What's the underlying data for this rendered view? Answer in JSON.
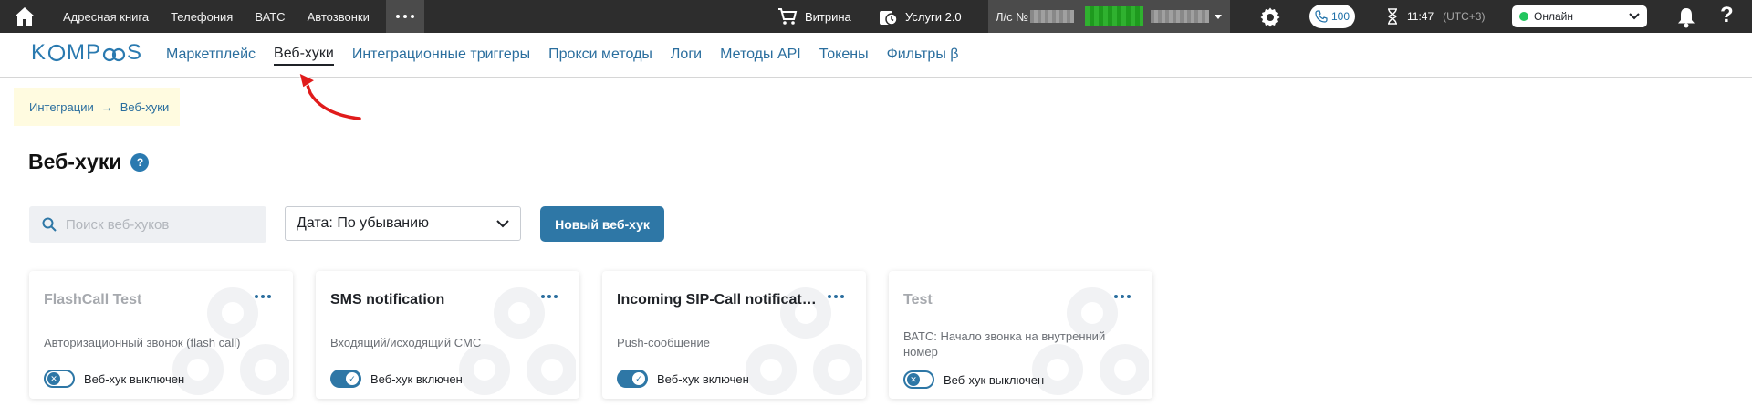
{
  "topbar": {
    "links": [
      "Адресная книга",
      "Телефония",
      "ВАТС",
      "Автозвонки"
    ],
    "shop_label": "Витрина",
    "services_label": "Услуги 2.0",
    "account_prefix": "Л/с №",
    "calls_count": "100",
    "time": "11:47",
    "timezone": "(UTC+3)",
    "status": "Онлайн",
    "help": "?"
  },
  "subnav": {
    "logo_prefix": "K",
    "logo_middle": "MP",
    "logo_suffix": "S",
    "items": [
      "Маркетплейс",
      "Веб-хуки",
      "Интеграционные триггеры",
      "Прокси методы",
      "Логи",
      "Методы API",
      "Токены",
      "Фильтры β"
    ],
    "active_index": 1
  },
  "breadcrumb": {
    "parent": "Интеграции",
    "separator": "→",
    "current": "Веб-хуки"
  },
  "page": {
    "title": "Веб-хуки",
    "help": "?"
  },
  "controls": {
    "search_placeholder": "Поиск веб-хуков",
    "sort_label": "Дата: По убыванию",
    "new_button": "Новый веб-хук"
  },
  "cards": [
    {
      "title": "FlashCall Test",
      "description": "Авторизационный звонок (flash call)",
      "enabled": false,
      "toggle_label": "Веб-хук выключен"
    },
    {
      "title": "SMS notification",
      "description": "Входящий/исходящий СМС",
      "enabled": true,
      "toggle_label": "Веб-хук включен"
    },
    {
      "title": "Incoming SIP-Call notification",
      "description": "Push-сообщение",
      "enabled": true,
      "toggle_label": "Веб-хук включен"
    },
    {
      "title": "Test",
      "description": "ВАТС: Начало звонка на внутренний номер",
      "enabled": false,
      "toggle_label": "Веб-хук выключен"
    }
  ],
  "colors": {
    "topbar": "#2d2d2d",
    "accent": "#2e77a6",
    "link": "#2a6e9e",
    "breadcrumb_bg": "#fffbe0",
    "online": "#22c55e",
    "annotation": "#e01b1b"
  },
  "icons": [
    "home-icon",
    "cart-icon",
    "services-icon",
    "gear-icon",
    "phone-icon",
    "hourglass-icon",
    "bell-icon",
    "search-icon",
    "chevron-down-icon",
    "more-icon",
    "webhook-watermark-icon"
  ]
}
